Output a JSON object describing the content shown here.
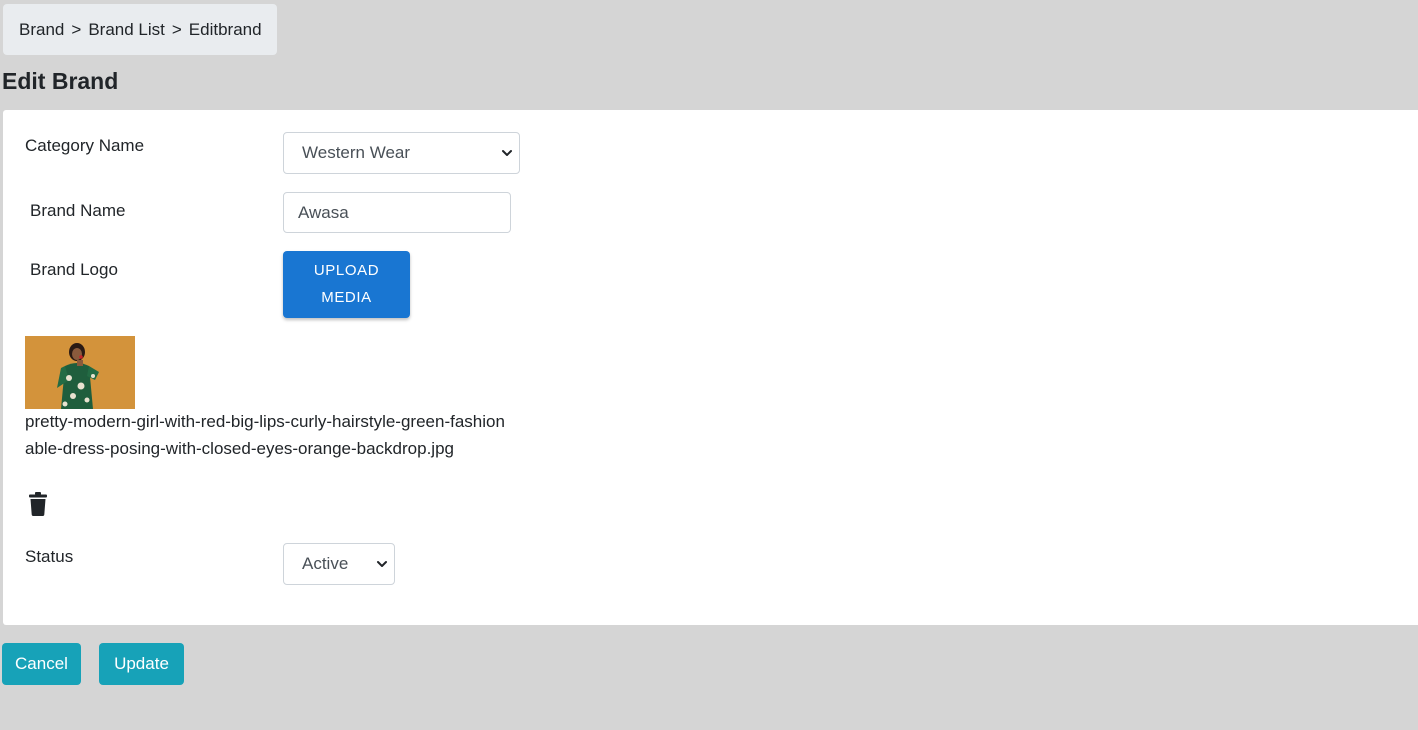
{
  "breadcrumb": {
    "items": [
      "Brand",
      "Brand List",
      "Editbrand"
    ],
    "separator": ">"
  },
  "page_title": "Edit Brand",
  "form": {
    "category": {
      "label": "Category Name",
      "selected": "Western Wear"
    },
    "brand_name": {
      "label": "Brand Name",
      "value": "Awasa"
    },
    "brand_logo": {
      "label": "Brand Logo",
      "upload_line1": "UPLOAD",
      "upload_line2": "MEDIA",
      "file_name": "pretty-modern-girl-with-red-big-lips-curly-hairstyle-green-fashionable-dress-posing-with-closed-eyes-orange-backdrop.jpg",
      "delete_icon": "trash-icon"
    },
    "status": {
      "label": "Status",
      "selected": "Active"
    }
  },
  "actions": {
    "cancel_label": "Cancel",
    "update_label": "Update"
  },
  "colors": {
    "page_bg": "#d5d5d5",
    "card_bg": "#ffffff",
    "upload_button": "#1976d2",
    "action_button": "#17a2b8",
    "breadcrumb_bg": "#e9ecef"
  }
}
